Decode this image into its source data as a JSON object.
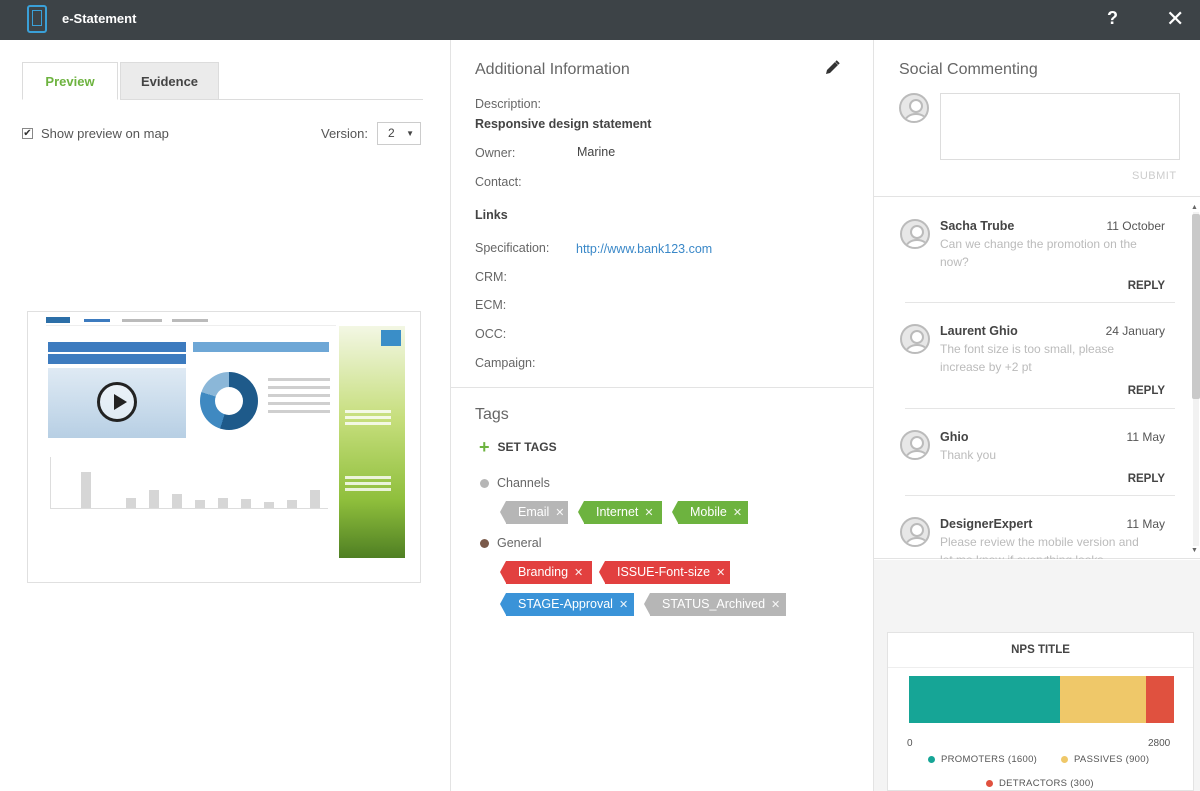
{
  "window": {
    "title": "e-Statement",
    "help_label": "?",
    "close_label": "✕"
  },
  "left": {
    "tabs": [
      {
        "label": "Preview"
      },
      {
        "label": "Evidence"
      }
    ],
    "show_preview_label": "Show preview on map",
    "version_label": "Version:",
    "version_value": "2"
  },
  "info": {
    "title": "Additional Information",
    "description_label": "Description:",
    "description_value": "Responsive design statement",
    "owner_label": "Owner:",
    "owner_value": "Marine",
    "contact_label": "Contact:",
    "links_title": "Links",
    "specification_label": "Specification:",
    "specification_value": "http://www.bank123.com",
    "crm_label": "CRM:",
    "ecm_label": "ECM:",
    "occ_label": "OCC:",
    "campaign_label": "Campaign:"
  },
  "tags": {
    "title": "Tags",
    "set_tags_label": "SET TAGS",
    "groups": [
      {
        "name": "Channels",
        "color": "#b6b6b6",
        "items": [
          {
            "label": "Email",
            "color": "gray"
          },
          {
            "label": "Internet",
            "color": "green"
          },
          {
            "label": "Mobile",
            "color": "green"
          }
        ]
      },
      {
        "name": "General",
        "color": "#7a5a4a",
        "items": [
          {
            "label": "Branding",
            "color": "red"
          },
          {
            "label": "ISSUE-Font-size",
            "color": "red"
          },
          {
            "label": "STAGE-Approval",
            "color": "blue"
          },
          {
            "label": "STATUS_Archived",
            "color": "gray"
          }
        ]
      }
    ]
  },
  "social": {
    "title": "Social Commenting",
    "submit_label": "SUBMIT",
    "comments": [
      {
        "author": "Sacha Trube",
        "date": "11 October",
        "text": "Can we change the promotion on the now?",
        "reply": "REPLY"
      },
      {
        "author": "Laurent Ghio",
        "date": "24 January",
        "text": "The font size is too small, please increase by +2 pt",
        "reply": "REPLY"
      },
      {
        "author": "Ghio",
        "date": "11 May",
        "text": "Thank you",
        "reply": "REPLY"
      },
      {
        "author": "DesignerExpert",
        "date": "11 May",
        "text": "Please review the mobile version and let me know if everything looks",
        "reply": ""
      }
    ]
  },
  "nps": {
    "title": "NPS TITLE",
    "axis_min": "0",
    "axis_max": "2800",
    "total": 2800,
    "segments": [
      {
        "name": "PROMOTERS (1600)",
        "value": 1600,
        "color": "#16a596"
      },
      {
        "name": "PASSIVES (900)",
        "value": 900,
        "color": "#efc869"
      },
      {
        "name": "DETRACTORS (300)",
        "value": 300,
        "color": "#e0513f"
      }
    ]
  }
}
